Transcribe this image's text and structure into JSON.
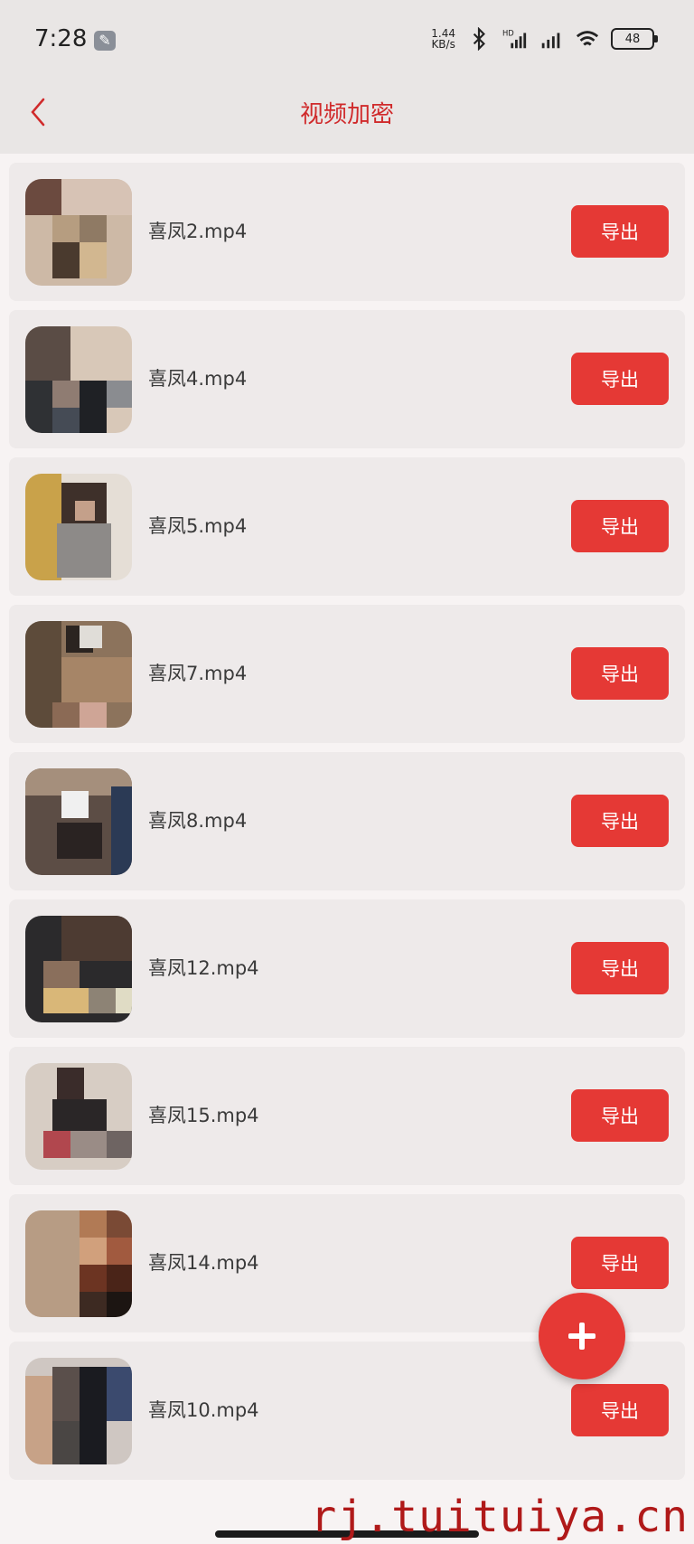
{
  "status_bar": {
    "time": "7:28",
    "speed_value": "1.44",
    "speed_unit": "KB/s",
    "battery": "48",
    "hd_label": "HD"
  },
  "nav": {
    "title": "视频加密"
  },
  "items": [
    {
      "name": "喜凤2.mp4",
      "action": "导出"
    },
    {
      "name": "喜凤4.mp4",
      "action": "导出"
    },
    {
      "name": "喜凤5.mp4",
      "action": "导出"
    },
    {
      "name": "喜凤7.mp4",
      "action": "导出"
    },
    {
      "name": "喜凤8.mp4",
      "action": "导出"
    },
    {
      "name": "喜凤12.mp4",
      "action": "导出"
    },
    {
      "name": "喜凤15.mp4",
      "action": "导出"
    },
    {
      "name": "喜凤14.mp4",
      "action": "导出"
    },
    {
      "name": "喜凤10.mp4",
      "action": "导出"
    }
  ],
  "fab": {
    "icon": "plus-icon"
  },
  "watermark": "rj.tuituiya.cn",
  "colors": {
    "accent": "#e53935",
    "title": "#d02a2b",
    "card": "#eeeaea",
    "header": "#e9e6e5"
  }
}
